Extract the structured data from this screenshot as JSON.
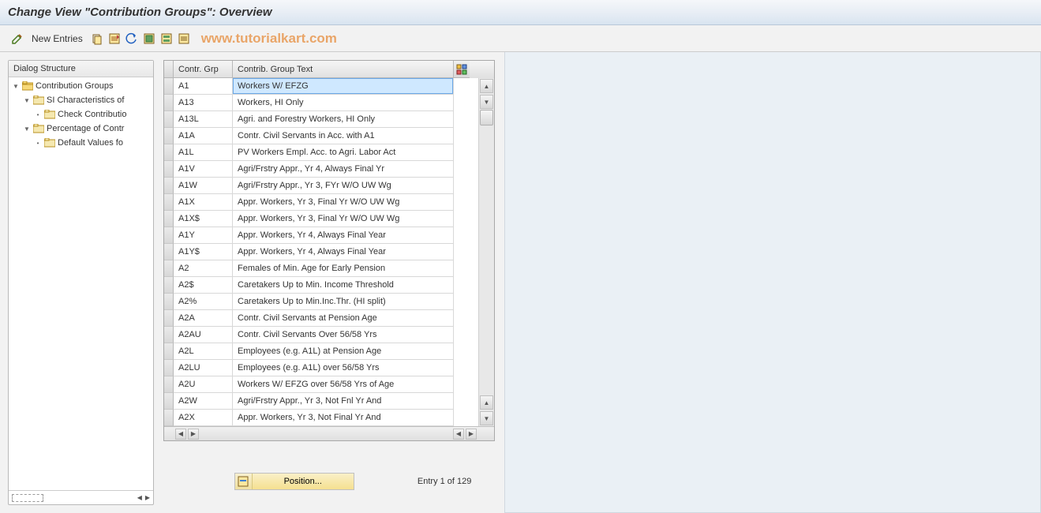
{
  "header": {
    "title": "Change View \"Contribution Groups\": Overview"
  },
  "toolbar": {
    "new_entries_label": "New Entries"
  },
  "watermark": "www.tutorialkart.com",
  "tree": {
    "header": "Dialog Structure",
    "nodes": [
      {
        "label": "Contribution Groups",
        "indent": 0,
        "expanded": true,
        "open": true
      },
      {
        "label": "SI Characteristics of",
        "indent": 1,
        "expanded": true,
        "open": false
      },
      {
        "label": "Check Contributio",
        "indent": 2,
        "leaf": true,
        "open": false
      },
      {
        "label": "Percentage of Contr",
        "indent": 1,
        "expanded": true,
        "open": false
      },
      {
        "label": "Default Values fo",
        "indent": 2,
        "leaf": true,
        "open": false
      }
    ]
  },
  "table": {
    "columns": {
      "grp": "Contr. Grp",
      "txt": "Contrib. Group Text"
    },
    "rows": [
      {
        "grp": "A1",
        "txt": "Workers W/ EFZG",
        "selected": true
      },
      {
        "grp": "A13",
        "txt": "Workers, HI Only"
      },
      {
        "grp": "A13L",
        "txt": "Agri. and Forestry Workers, HI Only"
      },
      {
        "grp": "A1A",
        "txt": "Contr. Civil Servants in Acc. with A1"
      },
      {
        "grp": "A1L",
        "txt": "PV Workers Empl. Acc. to Agri. Labor Act"
      },
      {
        "grp": "A1V",
        "txt": "Agri/Frstry Appr., Yr 4, Always Final Yr"
      },
      {
        "grp": "A1W",
        "txt": "Agri/Frstry Appr., Yr 3, FYr W/O UW Wg"
      },
      {
        "grp": "A1X",
        "txt": "Appr. Workers, Yr 3, Final Yr W/O UW Wg"
      },
      {
        "grp": "A1X$",
        "txt": "Appr. Workers, Yr 3, Final Yr W/O UW Wg"
      },
      {
        "grp": "A1Y",
        "txt": "Appr. Workers, Yr 4, Always Final Year"
      },
      {
        "grp": "A1Y$",
        "txt": "Appr. Workers, Yr 4, Always Final Year"
      },
      {
        "grp": "A2",
        "txt": "Females of Min. Age for Early Pension"
      },
      {
        "grp": "A2$",
        "txt": "Caretakers Up to Min. Income Threshold"
      },
      {
        "grp": "A2%",
        "txt": "Caretakers Up to Min.Inc.Thr. (HI split)"
      },
      {
        "grp": "A2A",
        "txt": "Contr. Civil Servants at Pension Age"
      },
      {
        "grp": "A2AU",
        "txt": "Contr. Civil Servants Over 56/58 Yrs"
      },
      {
        "grp": "A2L",
        "txt": "Employees (e.g. A1L) at Pension Age"
      },
      {
        "grp": "A2LU",
        "txt": "Employees (e.g. A1L) over 56/58 Yrs"
      },
      {
        "grp": "A2U",
        "txt": "Workers W/ EFZG over 56/58 Yrs of Age"
      },
      {
        "grp": "A2W",
        "txt": "Agri/Frstry Appr., Yr 3, Not Fnl Yr And"
      },
      {
        "grp": "A2X",
        "txt": "Appr. Workers, Yr 3, Not Final Yr And"
      }
    ]
  },
  "footer": {
    "position_label": "Position...",
    "entry_status": "Entry 1 of 129"
  }
}
